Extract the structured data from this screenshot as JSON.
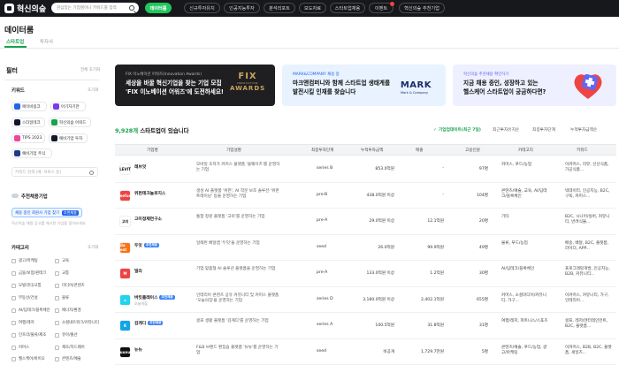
{
  "app": {
    "logo_text": "혁신의숲",
    "search_placeholder": "관심있는 기업명이나 키워드를 입력",
    "nav": [
      "데이터룸",
      "신규투자유치",
      "인공지능투자",
      "분석리포트",
      "보도자료",
      "스타트업채용",
      "이벤트",
      "혁신의숲 추천기업"
    ],
    "nav_active": "데이터룸"
  },
  "page": {
    "title": "데이터룸",
    "tabs": [
      "스타트업",
      "투자사"
    ],
    "tab_active": "스타트업"
  },
  "filter": {
    "title": "필터",
    "reset_all": "전체 초기화",
    "keyword_section": "키워드",
    "keyword_reset": "초기화",
    "keywords": [
      {
        "label": "에이비링크",
        "color": "#2563eb"
      },
      {
        "label": "아기자기한",
        "color": "#7c3aed"
      },
      {
        "label": "스타일테크",
        "color": "#0f172a"
      },
      {
        "label": "혁신의숲 어워드",
        "color": "#16a34a"
      },
      {
        "label": "TIPS 2023",
        "color": "#ec4899"
      },
      {
        "label": "예비기업 투자",
        "color": "#111827"
      },
      {
        "label": "예비기업 주식",
        "color": "#1e3a8a"
      }
    ],
    "search_placeholder": "키워드 검색 (예: 서비스 등)",
    "recommend_section": "추천채용기업",
    "recommend_chip": "채용 중인 회원사 기업 찾기",
    "recommend_badge": "추천채용",
    "recommend_note": "혁신의숲 채용 공고를 게시한 기업을 찾아보세요",
    "category_section": "카테고리",
    "category_reset": "초기화",
    "categories_left": [
      "광고/마케팅",
      "금융/보험/핀테크",
      "모빌리티/교통",
      "부동산/건설",
      "AI/딥테크/블록체인",
      "여행/레저",
      "인프라/물류/제조",
      "커머스",
      "헬스케어/바이오"
    ],
    "categories_right": [
      "교육",
      "교통",
      "미디어/콘텐츠",
      "물류",
      "에너지/환경",
      "소셜네트워크/커뮤니티",
      "유아/출산",
      "제조/하드웨어",
      "콘텐츠/예술",
      "패션"
    ]
  },
  "banners": [
    {
      "small": "FIX 이노베이션 어워즈(Innovation Awards)",
      "line1": "세상을 바꿀 혁신기업을 찾는 기업 모집",
      "line2": "'FIX 이노베이션 어워즈'에 도전하세요!",
      "art_top": "FIX",
      "art_mid": "INNOVATION",
      "art_bottom": "AWARDS"
    },
    {
      "small": "MARK&COMPANY 채용 중",
      "line1": "마크앤컴퍼니와 함께 스타트업 생태계를",
      "line2": "발전시킬 인재를 찾습니다",
      "logo": "MARK",
      "logo_sub": "Mark & Company"
    },
    {
      "small": "혁신의숲 추천채용 확인하기",
      "line1": "지금 채용 중인, 성장하고 있는",
      "line2": "헬스케어 스타트업이 궁금하다면?"
    }
  ],
  "results": {
    "count": "9,928개",
    "count_suffix": " 스타트업이 있습니다",
    "sorts": [
      "기업업데이트(최근 7일)",
      "최근투자유치순",
      "최종투자단계",
      "누적투자금액순"
    ],
    "sort_active": "기업업데이트(최근 7일)"
  },
  "table": {
    "headers": [
      "기업명",
      "기업설명",
      "최종투자단계",
      "누적투자금액",
      "매출",
      "고용인원",
      "카테고리",
      "키워드"
    ],
    "rows": [
      {
        "name": "레브잇",
        "badge": "",
        "sub": "",
        "logo_text": "LEVIT",
        "logo_color": "#ffffff",
        "logo_text_color": "#111111",
        "desc": "모바일 초저가 커머스 플랫폼 '올웨이즈'를 운영하는 기업",
        "stage": "series B",
        "invest": "853.0억원",
        "sales": "-",
        "employees": "97명",
        "category": "커머스, 푸드/농업",
        "keywords": "이커머스, 리뷰, 신선식품, 가공식품..."
      },
      {
        "name": "위펀테크놀로지스",
        "badge": "",
        "sub": "",
        "logo_text": "wefun",
        "logo_color": "#ef4444",
        "logo_text_color": "#ffffff",
        "desc": "생성 AI 플랫폼 '위펀', AI 작문 보조 솔루션 '위펀 트레이닝' 등을 운영하는 기업",
        "stage": "pre-B",
        "invest": "438.0억원 이상",
        "sales": "-",
        "employees": "104명",
        "category": "콘텐츠/예술, 교육, AI/딥테크/블록체인",
        "keywords": "빅데이터, 인공지능, B2C, 구독, 커머스..."
      },
      {
        "name": "고미정제연구소",
        "badge": "",
        "sub": "",
        "logo_text": "고미",
        "logo_color": "#ffffff",
        "logo_text_color": "#111111",
        "desc": "통합 정원 플랫폼 '고미'를 운영하는 기업",
        "stage": "pre-A",
        "invest": "29.0억원 이상",
        "sales": "12.1억원",
        "employees": "20명",
        "category": "기타",
        "keywords": "B2C, 시니어/실버, 커뮤니티, 반려식물..."
      },
      {
        "name": "두잇",
        "badge": "추천채용",
        "sub": "",
        "logo_text": "do eat",
        "logo_color": "#f97316",
        "logo_text_color": "#ffffff",
        "desc": "일례된 배달앱 '두잇'을 운영하는 기업",
        "stage": "seed",
        "invest": "26.0억원",
        "sales": "99.9억원",
        "employees": "49명",
        "category": "물류, 푸드/농업",
        "keywords": "배송, 배달, B2C, 플랫폼, 라이더, APP..."
      },
      {
        "name": "밀리",
        "badge": "",
        "sub": "",
        "logo_text": "M",
        "logo_color": "#ef4444",
        "logo_text_color": "#ffffff",
        "desc": "기업 맞춤형 AI 솔루션 플랫폼을 운영하는 기업",
        "stage": "pre-A",
        "invest": "133.0억원 이상",
        "sales": "1.2억원",
        "employees": "30명",
        "category": "AI/딥테크/블록체인",
        "keywords": "프로그래밍개발, 인공지능, B2B, 커뮤니티..."
      },
      {
        "name": "버킷플레이스",
        "badge": "추천채용",
        "sub": "오늘의집",
        "logo_text": "⌂",
        "logo_color": "#22d3ee",
        "logo_text_color": "#ffffff",
        "desc": "인테리어 콘텐츠 공유 커뮤니티 및 커머스 플랫폼 '오늘의집'을 운영하는 기업",
        "stage": "series D",
        "invest": "3,180.0억원 이상",
        "sales": "2,402.1억원",
        "employees": "655명",
        "category": "커머스, 소셜미디어/커뮤니티, 가구...",
        "keywords": "이커머스, 커뮤니티, 가구, 인테리어..."
      },
      {
        "name": "김캐디",
        "badge": "추천채용",
        "sub": "",
        "logo_text": "K",
        "logo_color": "#0ea5e9",
        "logo_text_color": "#ffffff",
        "desc": "골프 생활 플랫폼 '김캐디'를 운영하는 기업",
        "stage": "series A",
        "invest": "100.5억원",
        "sales": "31.8억원",
        "employees": "31명",
        "category": "여행/레저, 피트니스/스포츠",
        "keywords": "골프, 레저/엔터테인먼트, B2C, 플랫폼..."
      },
      {
        "name": "뉴뉴",
        "badge": "",
        "sub": "",
        "logo_text": "nuunuu",
        "logo_color": "#111111",
        "logo_text_color": "#ffffff",
        "desc": "F&B 브랜드 편집숍 플랫폼 '뉴뉴'를 운영하는 기업",
        "stage": "seed",
        "invest": "비공개",
        "sales": "1,729.7만원",
        "employees": "5명",
        "category": "콘텐츠/예술, 푸드/농업, 광고/마케팅",
        "keywords": "이커머스, B2B, B2C, 플랫폼, 세일즈..."
      }
    ]
  },
  "colors": {
    "accent": "#16a34a",
    "nav_bg": "#17181b",
    "nav_active": "#22c55e",
    "badge": "#3b82f6"
  }
}
